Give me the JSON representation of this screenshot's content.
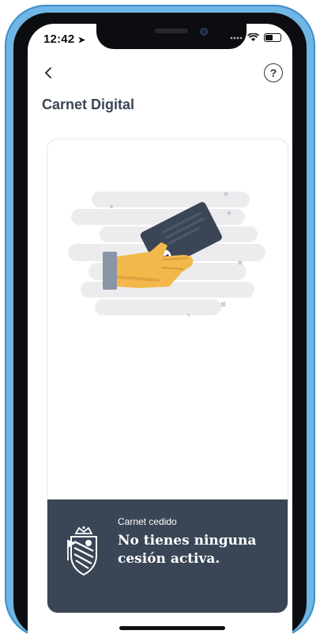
{
  "status_bar": {
    "time": "12:42"
  },
  "header": {
    "title": "Carnet Digital",
    "help_label": "?"
  },
  "info_panel": {
    "label": "Carnet cedido",
    "message": "No tienes ninguna cesión activa."
  },
  "colors": {
    "panel_background": "#3a4555",
    "title_text": "#3b4655",
    "hand_skin": "#f2b84b",
    "sleeve": "#8a96a6",
    "card_dark": "#3b4555"
  }
}
